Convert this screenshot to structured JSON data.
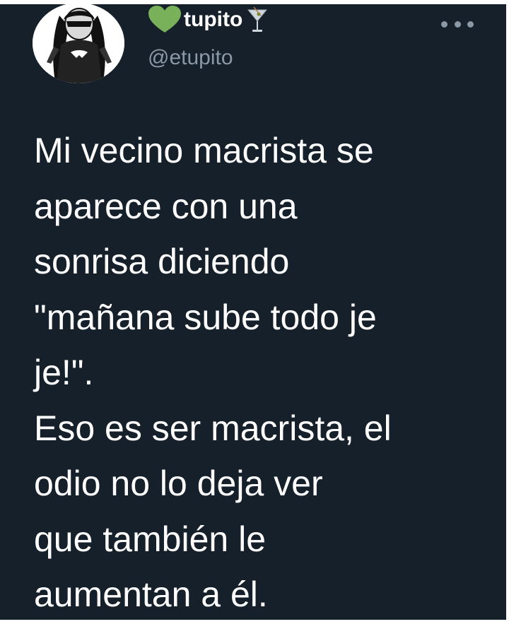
{
  "tweet": {
    "author": {
      "display_name": "tupito",
      "handle": "@etupito",
      "name_prefix_icon": "green-heart-icon",
      "name_suffix_icon": "cocktail-glass-icon",
      "avatar_icon": "profile-avatar"
    },
    "menu_icon": "more-options-icon",
    "text_lines": [
      "Mi vecino macrista se",
      "aparece con una",
      "sonrisa diciendo",
      "\"mañana sube todo je",
      "je!\".",
      "Eso es ser macrista, el",
      "odio no lo deja ver",
      "que también le",
      "aumentan a él."
    ]
  },
  "colors": {
    "background": "#15202b",
    "text": "#ffffff",
    "secondary_text": "#8b98a5",
    "heart": "#78b159"
  }
}
